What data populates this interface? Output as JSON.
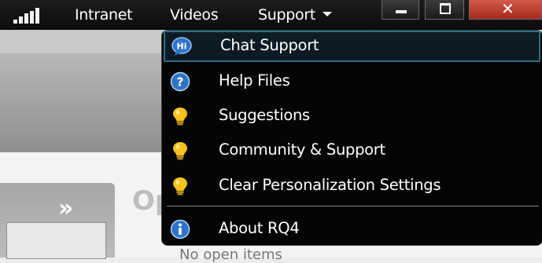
{
  "topbar": {
    "icons": {
      "signal": "signal-bars-icon"
    },
    "nav": [
      {
        "label": "Intranet"
      },
      {
        "label": "Videos"
      },
      {
        "label": "Support"
      }
    ],
    "window_controls": {
      "minimize": "minimize-icon",
      "maximize": "maximize-icon",
      "close": "close-icon"
    }
  },
  "background": {
    "panel_title": "Open Items",
    "panel_subtitle": "No open items",
    "chevron_icon": "double-chevron-right-icon"
  },
  "menu": {
    "items": [
      {
        "label": "Chat Support",
        "icon": "chat-hi-icon",
        "highlighted": true
      },
      {
        "label": "Help Files",
        "icon": "help-question-icon"
      },
      {
        "label": "Suggestions",
        "icon": "lightbulb-icon"
      },
      {
        "label": "Community & Support",
        "icon": "lightbulb-icon"
      },
      {
        "label": "Clear Personalization Settings",
        "icon": "lightbulb-icon"
      },
      {
        "label": "About RQ4",
        "icon": "info-icon"
      }
    ]
  },
  "colors": {
    "topbar": "#111111",
    "menu_bg": "#050505",
    "highlight_border": "#2c6f87",
    "icon_blue": "#2f73c9",
    "bulb_yellow": "#f7c21d",
    "close_red": "#c0392b"
  }
}
